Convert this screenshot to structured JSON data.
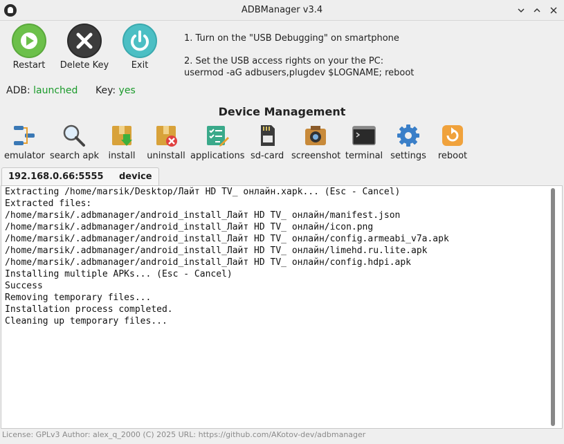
{
  "window": {
    "title": "ADBManager v3.4"
  },
  "actions": {
    "restart": "Restart",
    "delete_key": "Delete Key",
    "exit": "Exit"
  },
  "instructions": {
    "step1": "1. Turn on the \"USB Debugging\" on smartphone",
    "step2_line1": "2. Set the USB access rights on your the PC:",
    "step2_line2": "usermod -aG adbusers,plugdev $LOGNAME; reboot"
  },
  "status": {
    "adb_label": "ADB:",
    "adb_value": "launched",
    "key_label": "Key:",
    "key_value": "yes",
    "ok_color": "#1a9a2a"
  },
  "section": {
    "title": "Device Management"
  },
  "toolbar": {
    "emulator": "emulator",
    "search_apk": "search apk",
    "install": "install",
    "uninstall": "uninstall",
    "applications": "applications",
    "sd_card": "sd-card",
    "screenshot": "screenshot",
    "terminal": "terminal",
    "settings": "settings",
    "reboot": "reboot"
  },
  "tab": {
    "ip": "192.168.0.66:5555",
    "type": "device"
  },
  "console": {
    "lines": [
      "Extracting /home/marsik/Desktop/Лайт HD TV_ онлайн.xapk... (Esc - Cancel)",
      "Extracted files:",
      "/home/marsik/.adbmanager/android_install_Лайт HD TV_ онлайн/manifest.json",
      "/home/marsik/.adbmanager/android_install_Лайт HD TV_ онлайн/icon.png",
      "/home/marsik/.adbmanager/android_install_Лайт HD TV_ онлайн/config.armeabi_v7a.apk",
      "/home/marsik/.adbmanager/android_install_Лайт HD TV_ онлайн/limehd.ru.lite.apk",
      "/home/marsik/.adbmanager/android_install_Лайт HD TV_ онлайн/config.hdpi.apk",
      "Installing multiple APKs... (Esc - Cancel)",
      "Success",
      "Removing temporary files...",
      "Installation process completed.",
      "Cleaning up temporary files..."
    ]
  },
  "footer": {
    "text": "License: GPLv3   Author: alex_q_2000 (C) 2025   URL: https://github.com/AKotov-dev/adbmanager"
  }
}
